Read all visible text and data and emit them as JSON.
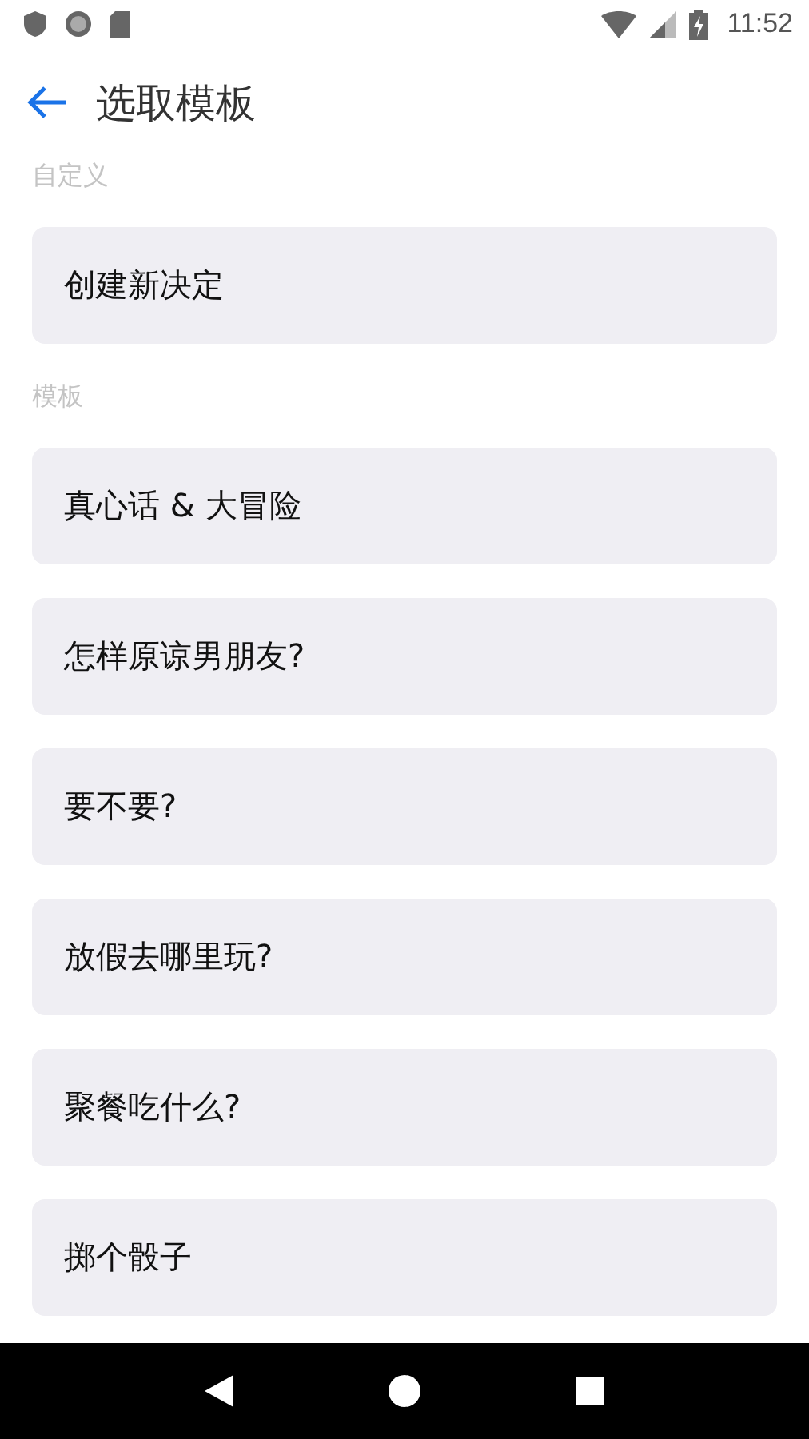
{
  "status_bar": {
    "time": "11:52"
  },
  "app_bar": {
    "title": "选取模板"
  },
  "sections": [
    {
      "label": "自定义",
      "items": [
        "创建新决定"
      ]
    },
    {
      "label": "模板",
      "items": [
        "真心话 & 大冒险",
        "怎样原谅男朋友?",
        "要不要?",
        "放假去哪里玩?",
        "聚餐吃什么?",
        "掷个骰子"
      ]
    }
  ]
}
